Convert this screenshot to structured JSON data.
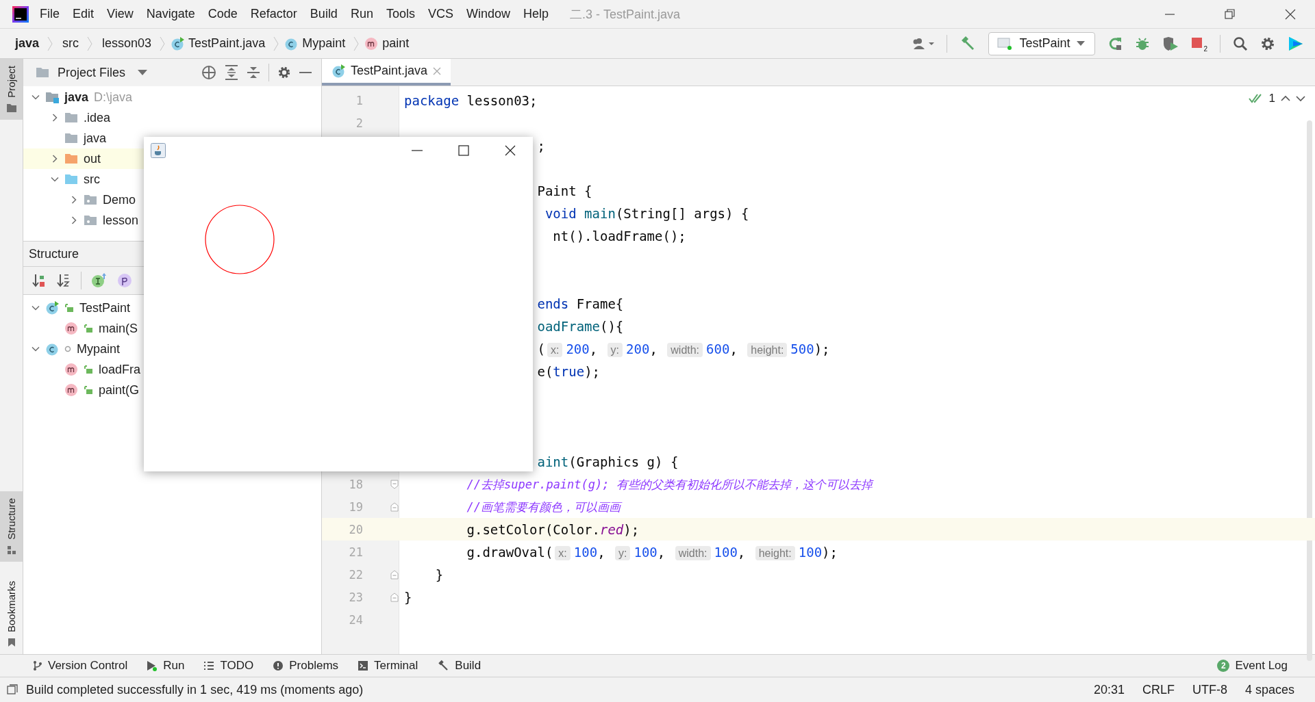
{
  "title_bar": {
    "menu": [
      "File",
      "Edit",
      "View",
      "Navigate",
      "Code",
      "Refactor",
      "Build",
      "Run",
      "Tools",
      "VCS",
      "Window",
      "Help"
    ],
    "title": "二.3 - TestPaint.java"
  },
  "breadcrumbs": [
    {
      "label": "java",
      "kind": "project"
    },
    {
      "label": "src",
      "kind": "folder"
    },
    {
      "label": "lesson03",
      "kind": "folder"
    },
    {
      "label": "TestPaint.java",
      "kind": "runnable-class"
    },
    {
      "label": "Mypaint",
      "kind": "class"
    },
    {
      "label": "paint",
      "kind": "method"
    }
  ],
  "toolbar": {
    "run_config": "TestPaint",
    "stop_badge": "2"
  },
  "left_strip": [
    {
      "label": "Project",
      "selected": true,
      "kind": "folder"
    },
    {
      "label": "Structure",
      "selected": true,
      "kind": "structure"
    },
    {
      "label": "Bookmarks",
      "selected": false,
      "kind": "bookmark"
    }
  ],
  "project_panel": {
    "title": "Project Files",
    "tree": [
      {
        "label": "java",
        "note": "D:\\java",
        "kind": "module",
        "expanded": true,
        "highlighted": false,
        "children": [
          {
            "label": ".idea",
            "kind": "folder",
            "expanded": false,
            "highlighted": false
          },
          {
            "label": "java",
            "kind": "folder",
            "highlighted": false
          },
          {
            "label": "out",
            "kind": "excluded",
            "expanded": false,
            "highlighted": true
          },
          {
            "label": "src",
            "kind": "source",
            "expanded": true,
            "highlighted": false,
            "children": [
              {
                "label": "Demo",
                "kind": "package",
                "expanded": false,
                "highlighted": false
              },
              {
                "label": "lesson",
                "kind": "package",
                "expanded": false,
                "highlighted": false
              }
            ]
          }
        ]
      }
    ]
  },
  "structure_panel": {
    "title": "Structure",
    "tree": [
      {
        "label": "TestPaint",
        "kind": "runnable-class",
        "public": true,
        "expanded": true,
        "children": [
          {
            "label": "main(S",
            "kind": "method",
            "public": true
          }
        ]
      },
      {
        "label": "Mypaint",
        "kind": "class",
        "public": false,
        "expanded": true,
        "children": [
          {
            "label": "loadFra",
            "kind": "method",
            "public": true
          },
          {
            "label": "paint(G",
            "kind": "method",
            "public": true
          }
        ]
      }
    ]
  },
  "editor": {
    "tab": {
      "label": "TestPaint.java",
      "selected": true
    },
    "inspection_count": "1",
    "lines": [
      {
        "number": "1",
        "current": false,
        "tokens": [
          {
            "kind": "keyword",
            "text": "package"
          },
          {
            "kind": "plain",
            "text": " lesson03;"
          }
        ]
      },
      {
        "number": "2",
        "current": false
      },
      {
        "current": false,
        "tokens": [
          {
            "kind": "plain",
            "text": "                 ;"
          }
        ]
      },
      {
        "current": false
      },
      {
        "current": false,
        "tokens": [
          {
            "kind": "plain",
            "text": "                 Paint {"
          }
        ]
      },
      {
        "current": false,
        "tokens": [
          {
            "kind": "keyword",
            "text": "                  void"
          },
          {
            "kind": "method",
            "text": " main"
          },
          {
            "kind": "plain",
            "text": "(String[] args) {"
          }
        ]
      },
      {
        "current": false,
        "tokens": [
          {
            "kind": "plain",
            "text": "                   nt().loadFrame();"
          }
        ]
      },
      {
        "current": false
      },
      {
        "current": false
      },
      {
        "current": false,
        "tokens": [
          {
            "kind": "keyword",
            "text": "                 ends"
          },
          {
            "kind": "plain",
            "text": " Frame{"
          }
        ]
      },
      {
        "current": false,
        "tokens": [
          {
            "kind": "method",
            "text": "                 oadFrame"
          },
          {
            "kind": "plain",
            "text": "(){"
          }
        ]
      },
      {
        "current": false,
        "tokens": [
          {
            "kind": "plain",
            "text": "                 ("
          },
          {
            "kind": "hint",
            "text": "x:"
          },
          {
            "kind": "number",
            "text": "200"
          },
          {
            "kind": "plain",
            "text": ", "
          },
          {
            "kind": "hint",
            "text": "y:"
          },
          {
            "kind": "number",
            "text": "200"
          },
          {
            "kind": "plain",
            "text": ", "
          },
          {
            "kind": "hint",
            "text": "width:"
          },
          {
            "kind": "number",
            "text": "600"
          },
          {
            "kind": "plain",
            "text": ", "
          },
          {
            "kind": "hint",
            "text": "height:"
          },
          {
            "kind": "number",
            "text": "500"
          },
          {
            "kind": "plain",
            "text": ");"
          }
        ]
      },
      {
        "current": false,
        "tokens": [
          {
            "kind": "plain",
            "text": "                 e("
          },
          {
            "kind": "keyword",
            "text": "true"
          },
          {
            "kind": "plain",
            "text": ");"
          }
        ]
      },
      {
        "current": false
      },
      {
        "current": false
      },
      {
        "current": false
      },
      {
        "current": false,
        "tokens": [
          {
            "kind": "method",
            "text": "                 aint"
          },
          {
            "kind": "plain",
            "text": "(Graphics g) {"
          }
        ]
      },
      {
        "number": "18",
        "current": false,
        "fold_marker": true,
        "fold_start": true,
        "tokens": [
          {
            "kind": "comment",
            "text": "        //去掉super.paint(g); 有些的父类有初始化所以不能去掉，这个可以去掉"
          }
        ]
      },
      {
        "number": "19",
        "current": false,
        "fold_marker": true,
        "fold_start": false,
        "tokens": [
          {
            "kind": "comment",
            "text": "        //画笔需要有颜色，可以画画"
          }
        ]
      },
      {
        "number": "20",
        "current": true,
        "tokens": [
          {
            "kind": "plain",
            "text": "        g.setColor(Color."
          },
          {
            "kind": "static",
            "text": "red"
          },
          {
            "kind": "plain",
            "text": ");"
          }
        ]
      },
      {
        "number": "21",
        "current": false,
        "tokens": [
          {
            "kind": "plain",
            "text": "        g.drawOval("
          },
          {
            "kind": "hint",
            "text": "x:"
          },
          {
            "kind": "number",
            "text": "100"
          },
          {
            "kind": "plain",
            "text": ", "
          },
          {
            "kind": "hint",
            "text": "y:"
          },
          {
            "kind": "number",
            "text": "100"
          },
          {
            "kind": "plain",
            "text": ", "
          },
          {
            "kind": "hint",
            "text": "width:"
          },
          {
            "kind": "number",
            "text": "100"
          },
          {
            "kind": "plain",
            "text": ", "
          },
          {
            "kind": "hint",
            "text": "height:"
          },
          {
            "kind": "number",
            "text": "100"
          },
          {
            "kind": "plain",
            "text": ");"
          }
        ]
      },
      {
        "number": "22",
        "current": false,
        "fold_marker": true,
        "fold_start": false,
        "tokens": [
          {
            "kind": "plain",
            "text": "    }"
          }
        ]
      },
      {
        "number": "23",
        "current": false,
        "fold_marker": true,
        "fold_start": false,
        "tokens": [
          {
            "kind": "plain",
            "text": "}"
          }
        ]
      },
      {
        "number": "24",
        "current": false
      }
    ]
  },
  "bottom_tools": [
    {
      "label": "Version Control",
      "kind": "vcs"
    },
    {
      "label": "Run",
      "kind": "run"
    },
    {
      "label": "TODO",
      "kind": "todo"
    },
    {
      "label": "Problems",
      "kind": "problems"
    },
    {
      "label": "Terminal",
      "kind": "terminal"
    },
    {
      "label": "Build",
      "kind": "build"
    }
  ],
  "event_log": {
    "label": "Event Log",
    "badge": "2"
  },
  "status_bar": {
    "message": "Build completed successfully in 1 sec, 419 ms (moments ago)",
    "items": [
      "20:31",
      "CRLF",
      "UTF-8",
      "4 spaces"
    ]
  }
}
